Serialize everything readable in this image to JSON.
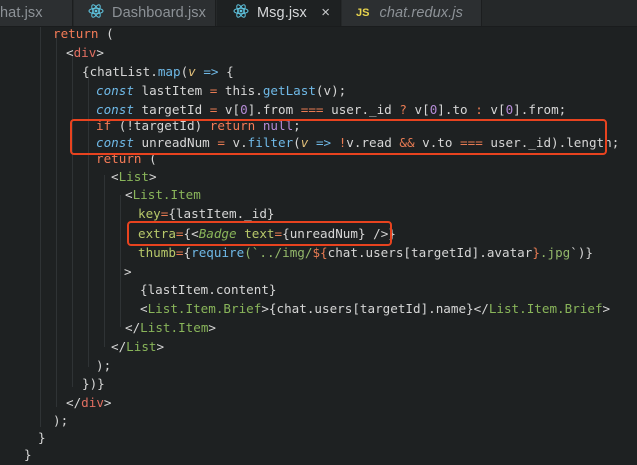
{
  "tabs": [
    {
      "label": "hat.jsx",
      "icon": "react-icon"
    },
    {
      "label": "Dashboard.jsx",
      "icon": "react-icon"
    },
    {
      "label": "Msg.jsx",
      "icon": "react-icon",
      "close": "×"
    },
    {
      "label": "chat.redux.js",
      "icon": "js-file-icon",
      "icon_text": "JS"
    }
  ],
  "code": {
    "l1": [
      "return ",
      "("
    ],
    "l2": [
      "<",
      "div",
      ">"
    ],
    "l3": [
      "{chatList.",
      "map",
      "(",
      "v",
      " => ",
      "{"
    ],
    "l4": [
      "const ",
      "lastItem ",
      "= ",
      "this.",
      "getLast",
      "(v);"
    ],
    "l5": [
      "const ",
      "targetId ",
      "= ",
      "v[",
      "0",
      "].from ",
      "=== ",
      "user._id ",
      "? ",
      "v[",
      "0",
      "].to ",
      ": ",
      "v[",
      "0",
      "].from;"
    ],
    "l6": [
      "if ",
      "(!targetId) ",
      "return ",
      "null",
      ";"
    ],
    "l7": [
      "const ",
      "unreadNum ",
      "= ",
      "v.",
      "filter",
      "(",
      "v",
      " => ",
      "!",
      "v.read ",
      "&& ",
      "v.to ",
      "=== ",
      "user._id).length;"
    ],
    "l8": [
      "return ",
      "("
    ],
    "l9": [
      "<",
      "List",
      ">"
    ],
    "l10": [
      "<",
      "List.Item"
    ],
    "l11": [
      "key",
      "=",
      "{lastItem._id}"
    ],
    "l12": [
      "extra",
      "=",
      "{<",
      "Badge ",
      "text",
      "=",
      "{unreadNum} ",
      "/>}"
    ],
    "l13": [
      "thumb",
      "=",
      "{",
      "require",
      "(`",
      "../img/",
      "${",
      "chat.users[targetId].avatar",
      "}",
      ".jpg",
      "`)}"
    ],
    "l14": [
      ">"
    ],
    "l15": [
      "{lastItem.content}"
    ],
    "l16": [
      "<",
      "List.Item.Brief",
      ">",
      "{chat.users[targetId].name}",
      "</",
      "List.Item.Brief",
      ">"
    ],
    "l17": [
      "</",
      "List.Item",
      ">"
    ],
    "l18": [
      "</",
      "List",
      ">"
    ],
    "l19": [
      ");"
    ],
    "l20": [
      "})}"
    ],
    "l21": [
      "</",
      "div",
      ">"
    ],
    "l22": [
      ");"
    ],
    "l23": [
      "}"
    ],
    "l24": [
      "}"
    ]
  },
  "colors": {
    "highlight_box": "#e8431f",
    "background": "#1e2122"
  }
}
